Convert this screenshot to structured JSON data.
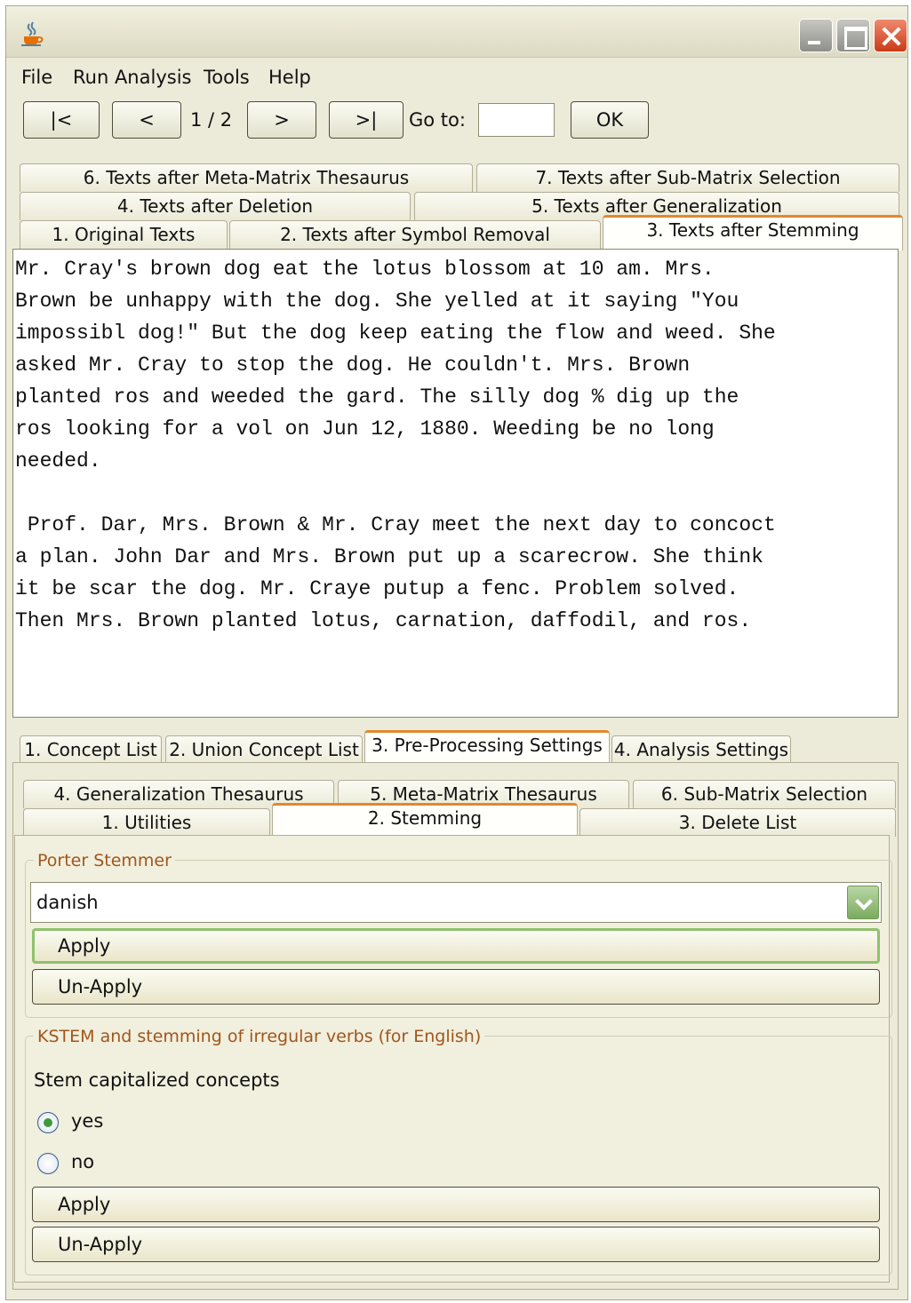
{
  "menu": {
    "items": [
      "File",
      "Run Analysis",
      "Tools",
      "Help"
    ]
  },
  "toolbar": {
    "first": "|<",
    "prev": "<",
    "page": "1 / 2",
    "next": ">",
    "last": ">|",
    "goto_label": "Go to:",
    "goto_value": "",
    "ok": "OK"
  },
  "text_tabs": {
    "row_top": [
      "6. Texts after Meta-Matrix Thesaurus",
      "7. Texts after Sub-Matrix Selection"
    ],
    "row_mid": [
      "4. Texts after Deletion",
      "5. Texts after Generalization"
    ],
    "row_bottom": [
      "1. Original Texts",
      "2. Texts after Symbol Removal",
      "3. Texts after Stemming"
    ],
    "selected": "3. Texts after Stemming"
  },
  "text_content": {
    "para1": "Mr. Cray's brown dog eat the lotus blossom at 10 am. Mrs.\nBrown be unhappy with the dog. She yelled at it saying \"You\nimpossibl dog!\" But the dog keep eating the flow and weed. She\nasked Mr. Cray to stop the dog. He couldn't. Mrs. Brown\nplanted ros and weeded the gard. The silly dog % dig up the\nros looking for a vol on Jun 12, 1880. Weeding be no long\nneeded.",
    "para2": " Prof. Dar, Mrs. Brown & Mr. Cray meet the next day to concoct\na plan. John Dar and Mrs. Brown put up a scarecrow. She think\nit be scar the dog. Mr. Craye putup a fenc. Problem solved.\nThen Mrs. Brown planted lotus, carnation, daffodil, and ros."
  },
  "settings_tabs": {
    "items": [
      "1. Concept List",
      "2. Union Concept List",
      "3. Pre-Processing Settings",
      "4. Analysis Settings"
    ],
    "selected": "3. Pre-Processing Settings"
  },
  "preprocessing_tabs": {
    "row_top": [
      "4. Generalization Thesaurus",
      "5. Meta-Matrix Thesaurus",
      "6. Sub-Matrix Selection"
    ],
    "row_bottom": [
      "1. Utilities",
      "2. Stemming",
      "3. Delete List"
    ],
    "selected": "2. Stemming"
  },
  "porter": {
    "title": "Porter Stemmer",
    "language": "danish",
    "apply": "Apply",
    "unapply": "Un-Apply"
  },
  "kstem": {
    "title": "KSTEM and stemming of irregular verbs (for English)",
    "question": "Stem capitalized concepts",
    "yes": "yes",
    "no": "no",
    "selected": "yes",
    "apply": "Apply",
    "unapply": "Un-Apply"
  },
  "colors": {
    "window_bg": "#ecead8",
    "active_tab_accent": "#e0892e",
    "group_title": "#a0561c",
    "focus_green": "#8fc16d"
  }
}
